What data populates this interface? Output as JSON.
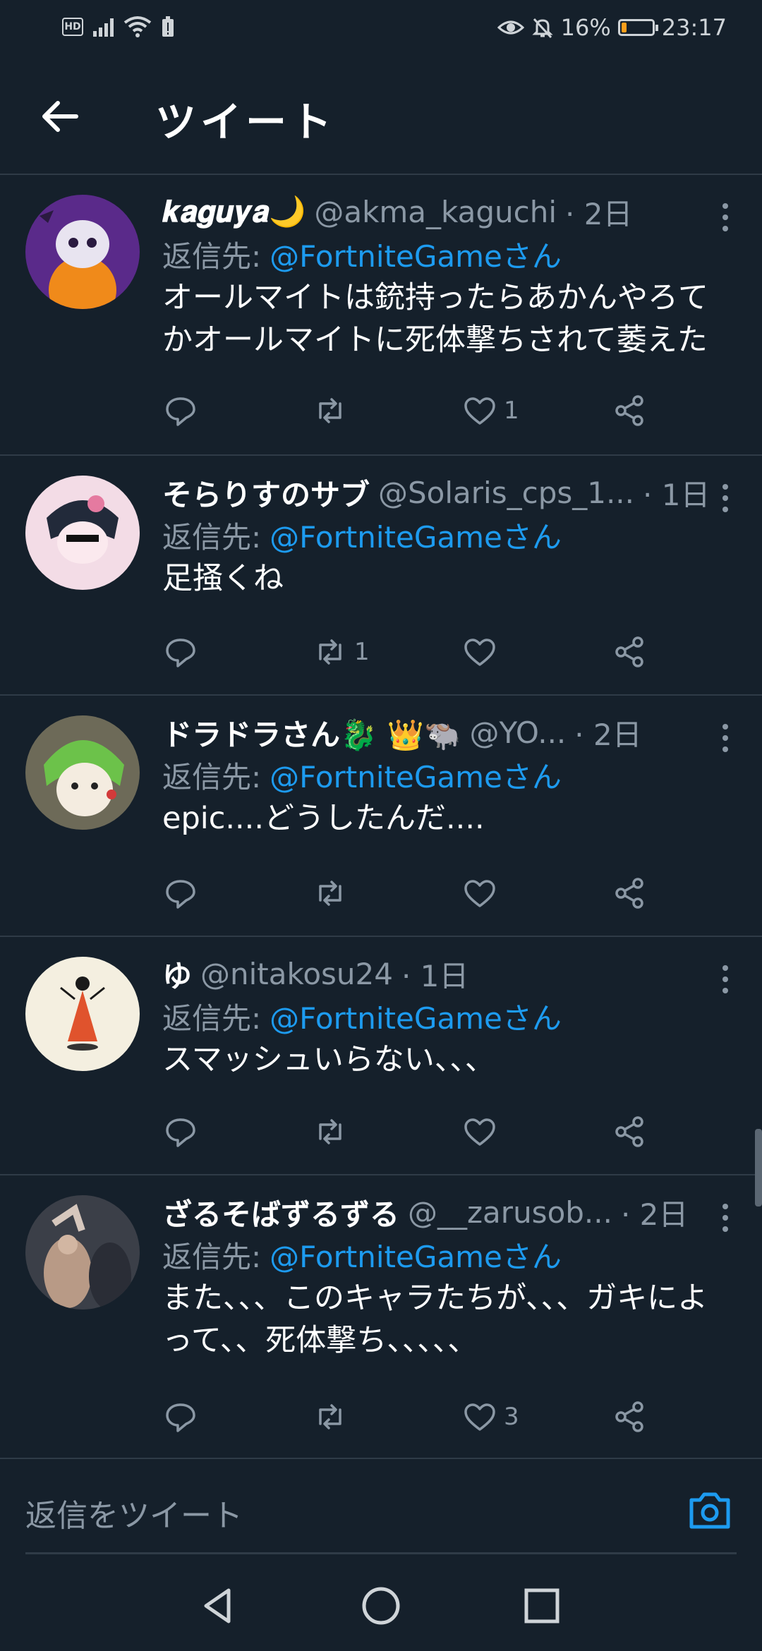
{
  "status_bar": {
    "hd": "HD",
    "battery_text": "16%",
    "time": "23:17",
    "battery_level": 0.16
  },
  "header": {
    "title": "ツイート"
  },
  "colors": {
    "background": "#15202b",
    "accent": "#1d9bf0",
    "muted": "#8b98a5",
    "divider": "#2f3b47"
  },
  "tweets": [
    {
      "name": "𝒌𝒂𝒈𝒖𝒚𝒂🌙",
      "handle": "@akma_kaguchi",
      "time": "· 2日",
      "reply_label": "返信先:",
      "reply_to": "@FortniteGameさん",
      "text": "オールマイトは銃持ったらあかんやろてかオールマイトに死体撃ちされて萎えた",
      "replies": "",
      "retweets": "",
      "likes": "1"
    },
    {
      "name": "そらりすのサブ",
      "handle": "@Solaris_cps_1...",
      "time": "· 1日",
      "reply_label": "返信先:",
      "reply_to": "@FortniteGameさん",
      "text": "足掻くね",
      "replies": "",
      "retweets": "1",
      "likes": ""
    },
    {
      "name": "ドラドラさん🐉 👑🐃",
      "handle": "@YO...",
      "time": "· 2日",
      "reply_label": "返信先:",
      "reply_to": "@FortniteGameさん",
      "text": "epic....どうしたんだ....",
      "replies": "",
      "retweets": "",
      "likes": ""
    },
    {
      "name": "ゆ",
      "handle": "@nitakosu24",
      "time": "· 1日",
      "reply_label": "返信先:",
      "reply_to": "@FortniteGameさん",
      "text": "スマッシュいらない、、、",
      "replies": "",
      "retweets": "",
      "likes": ""
    },
    {
      "name": "ざるそばずるずる",
      "handle": "@__zarusob...",
      "time": "· 2日",
      "reply_label": "返信先:",
      "reply_to": "@FortniteGameさん",
      "text": "また、、、このキャラたちが、、、ガキによって、、死体撃ち、、、、、",
      "replies": "",
      "retweets": "",
      "likes": "3"
    }
  ],
  "composer": {
    "placeholder": "返信をツイート"
  }
}
